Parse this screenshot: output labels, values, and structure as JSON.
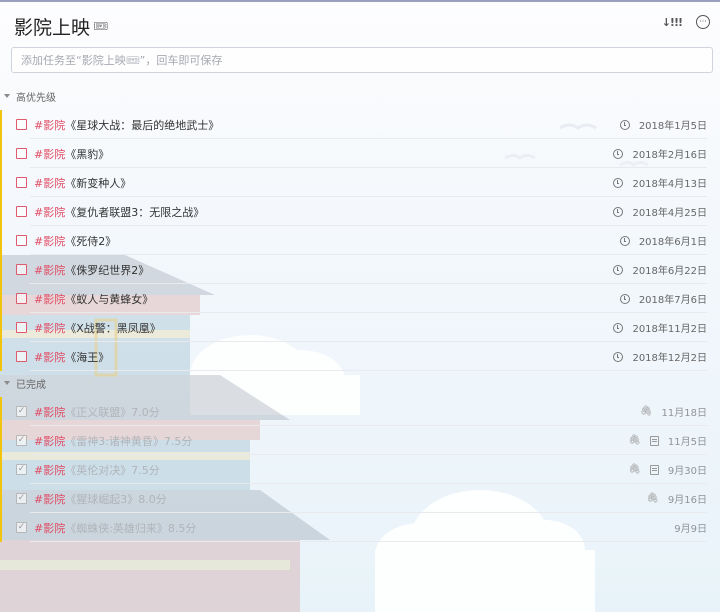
{
  "header": {
    "title": "影院上映",
    "title_emoji": "🎟"
  },
  "add_task": {
    "placeholder": "添加任务至“影院上映🎟”，回车即可保存"
  },
  "sections": {
    "high": {
      "label": "高优先级"
    },
    "done": {
      "label": "已完成"
    }
  },
  "tasks": [
    {
      "tag": "#影院",
      "name": "《星球大战：最后的绝地武士》",
      "date": "2018年1月5日"
    },
    {
      "tag": "#影院",
      "name": "《黑豹》",
      "date": "2018年2月16日"
    },
    {
      "tag": "#影院",
      "name": "《新变种人》",
      "date": "2018年4月13日"
    },
    {
      "tag": "#影院",
      "name": "《复仇者联盟3：无限之战》",
      "date": "2018年4月25日"
    },
    {
      "tag": "#影院",
      "name": "《死侍2》",
      "date": "2018年6月1日"
    },
    {
      "tag": "#影院",
      "name": "《侏罗纪世界2》",
      "date": "2018年6月22日"
    },
    {
      "tag": "#影院",
      "name": "《蚁人与黄蜂女》",
      "date": "2018年7月6日"
    },
    {
      "tag": "#影院",
      "name": "《X战警：黑凤凰》",
      "date": "2018年11月2日"
    },
    {
      "tag": "#影院",
      "name": "《海王》",
      "date": "2018年12月2日"
    }
  ],
  "completed": [
    {
      "tag": "#影院",
      "name": "《正义联盟》7.0分",
      "date": "11月18日"
    },
    {
      "tag": "#影院",
      "name": "《雷神3:诸神黄昏》7.5分",
      "date": "11月5日"
    },
    {
      "tag": "#影院",
      "name": "《英伦对决》7.5分",
      "date": "9月30日"
    },
    {
      "tag": "#影院",
      "name": "《猩球崛起3》8.0分",
      "date": "9月16日"
    },
    {
      "tag": "#影院",
      "name": "《蜘蛛侠:英雄归来》8.5分",
      "date": "9月9日"
    }
  ]
}
